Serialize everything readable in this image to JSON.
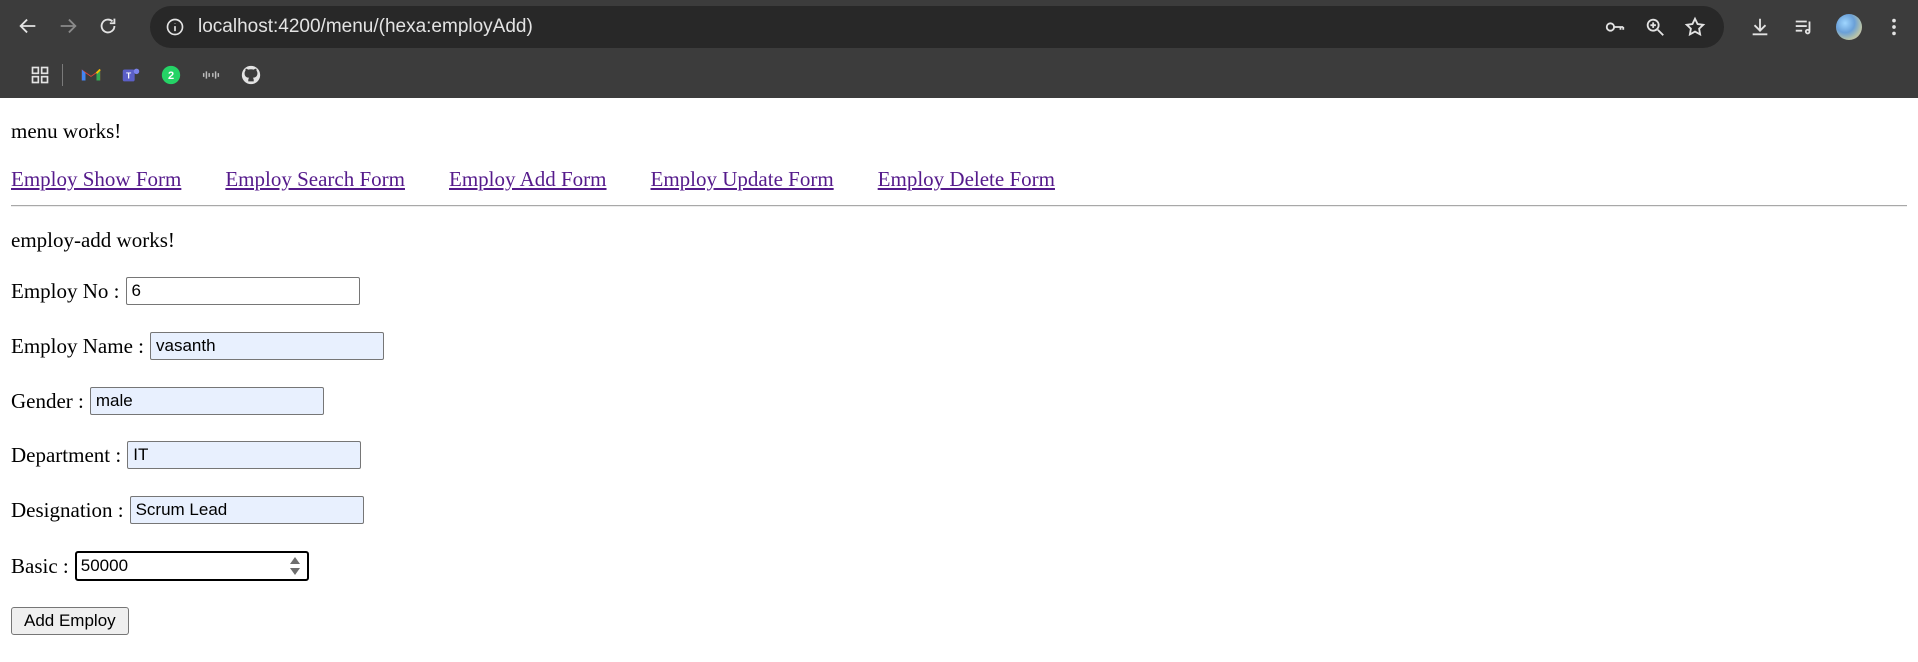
{
  "browser": {
    "url": "localhost:4200/menu/(hexa:employAdd)",
    "whatsapp_badge": "2"
  },
  "menu": {
    "title": "menu works!",
    "links": [
      "Employ Show Form",
      "Employ Search Form",
      "Employ Add Form",
      "Employ Update Form",
      "Employ Delete Form"
    ]
  },
  "form": {
    "title": "employ-add works!",
    "employ_no_label": "Employ No :",
    "employ_no_value": "6",
    "employ_name_label": "Employ Name :",
    "employ_name_value": "vasanth",
    "gender_label": "Gender :",
    "gender_value": "male",
    "department_label": "Department :",
    "department_value": "IT",
    "designation_label": "Designation :",
    "designation_value": "Scrum Lead",
    "basic_label": "Basic :",
    "basic_value": "50000",
    "submit_label": "Add Employ"
  },
  "colors": {
    "chrome_bg": "#3c3c3c",
    "omnibox_bg": "#282828",
    "visited_link": "#551a8b",
    "autofill_bg": "#e8f0fe"
  }
}
